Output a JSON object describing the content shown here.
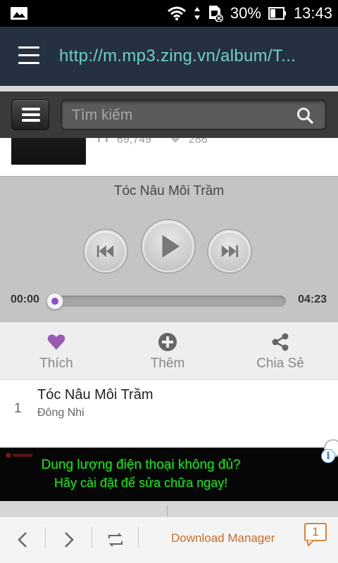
{
  "status_bar": {
    "battery_percent": "30%",
    "time": "13:43"
  },
  "browser": {
    "url": "http://m.mp3.zing.vn/album/T..."
  },
  "site_header": {
    "search_placeholder": "Tìm kiếm"
  },
  "album": {
    "stat_plays": "69,749",
    "stat_likes": "286"
  },
  "player": {
    "song_title": "Tóc Nâu Môi Trầm",
    "time_current": "00:00",
    "time_total": "04:23",
    "progress_fraction": 0.0
  },
  "actions": [
    {
      "label": "Thích",
      "icon": "heart-icon",
      "color": "#9b59b6"
    },
    {
      "label": "Thêm",
      "icon": "plus-circle-icon",
      "color": "#666666"
    },
    {
      "label": "Chia Sẻ",
      "icon": "share-icon",
      "color": "#666666"
    }
  ],
  "tracks": [
    {
      "number": "1",
      "title": "Tóc Nâu Môi Trầm",
      "artist": "Đông Nhi"
    }
  ],
  "ad": {
    "line1": "Dung lượng điện thoại không đủ?",
    "line2": "Hãy cài đặt để sửa chữa ngay!",
    "info_icon_label": "i",
    "text_color": "#28d428"
  },
  "bottom_bar": {
    "download_manager_label": "Download Manager",
    "tab_count": "1",
    "accent_color": "#c96b2d"
  }
}
